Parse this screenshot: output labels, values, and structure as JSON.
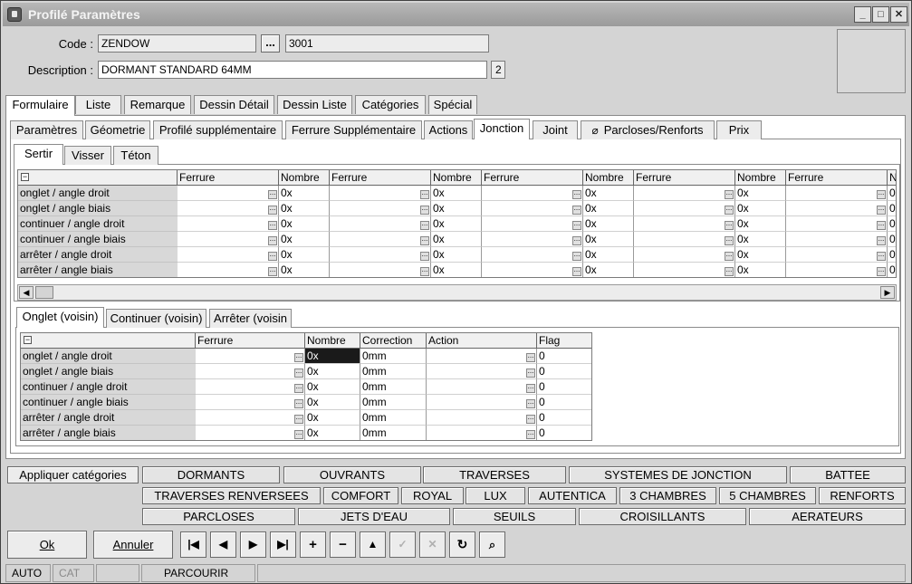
{
  "window": {
    "title": "Profilé Paramètres"
  },
  "header": {
    "code_label": "Code :",
    "code_value": "ZENDOW",
    "code_browse": "...",
    "code_number": "3001",
    "desc_label": "Description :",
    "desc_value": "DORMANT STANDARD 64MM",
    "desc_badge": "2"
  },
  "tabs_main": [
    "Formulaire",
    "Liste",
    "Remarque",
    "Dessin Détail",
    "Dessin Liste",
    "Catégories",
    "Spécial"
  ],
  "tabs_sub": [
    "Paramètres",
    "Géometrie",
    "Profilé supplémentaire",
    "Ferrure Supplémentaire",
    "Actions",
    "Jonction",
    "Joint",
    "Parcloses/Renforts",
    "Prix"
  ],
  "tabs_third": [
    "Sertir",
    "Visser",
    "Téton"
  ],
  "grid1": {
    "headers": [
      "Ferrure",
      "Nombre",
      "Ferrure",
      "Nombre",
      "Ferrure",
      "Nombre",
      "Ferrure",
      "Nombre",
      "Ferrure",
      "No"
    ],
    "rows": [
      "onglet / angle droit",
      "onglet / angle biais",
      "continuer / angle droit",
      "continuer / angle biais",
      "arrêter / angle droit",
      "arrêter / angle biais"
    ],
    "nombre": "0x"
  },
  "tabs_voisin": [
    "Onglet (voisin)",
    "Continuer (voisin)",
    "Arrêter (voisin"
  ],
  "grid2": {
    "headers": [
      "Ferrure",
      "Nombre",
      "Correction",
      "Action",
      "Flag"
    ],
    "rows": [
      {
        "label": "onglet / angle droit",
        "nombre": "0x",
        "correction": "0mm",
        "flag": "0"
      },
      {
        "label": "onglet / angle biais",
        "nombre": "0x",
        "correction": "0mm",
        "flag": "0"
      },
      {
        "label": "continuer / angle droit",
        "nombre": "0x",
        "correction": "0mm",
        "flag": "0"
      },
      {
        "label": "continuer / angle biais",
        "nombre": "0x",
        "correction": "0mm",
        "flag": "0"
      },
      {
        "label": "arrêter / angle droit",
        "nombre": "0x",
        "correction": "0mm",
        "flag": "0"
      },
      {
        "label": "arrêter / angle biais",
        "nombre": "0x",
        "correction": "0mm",
        "flag": "0"
      }
    ]
  },
  "categories": {
    "apply_label": "Appliquer catégories",
    "row1": [
      "DORMANTS",
      "OUVRANTS",
      "TRAVERSES",
      "SYSTEMES DE JONCTION",
      "BATTEE"
    ],
    "row2": [
      "TRAVERSES RENVERSEES",
      "COMFORT",
      "ROYAL",
      "LUX",
      "AUTENTICA",
      "3 CHAMBRES",
      "5 CHAMBRES",
      "RENFORTS"
    ],
    "row3": [
      "PARCLOSES",
      "JETS D'EAU",
      "SEUILS",
      "CROISILLANTS",
      "AERATEURS"
    ]
  },
  "actions": {
    "ok": "Ok",
    "cancel": "Annuler"
  },
  "status": {
    "mode": "AUTO",
    "cat": "CAT",
    "state": "PARCOURIR"
  }
}
